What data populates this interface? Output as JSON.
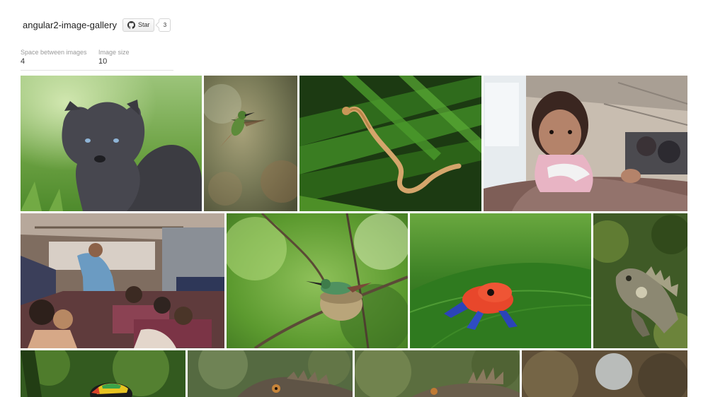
{
  "header": {
    "title": "angular2-image-gallery",
    "star_label": "Star",
    "star_count": "3",
    "star_icon": "github-octocat-icon"
  },
  "controls": {
    "spacing_label": "Space between images",
    "spacing_value": "4",
    "size_label": "Image size",
    "size_value": "10"
  },
  "gallery": {
    "rows": [
      [
        "arctic-fox",
        "hummingbird",
        "eyelash-snake",
        "girl-on-bus"
      ],
      [
        "bus-interior",
        "hummingbird-nest",
        "red-frog",
        "iguana"
      ],
      [
        "toucan",
        "iguana-close",
        "iguana-crest",
        "blurred-forest"
      ]
    ]
  }
}
